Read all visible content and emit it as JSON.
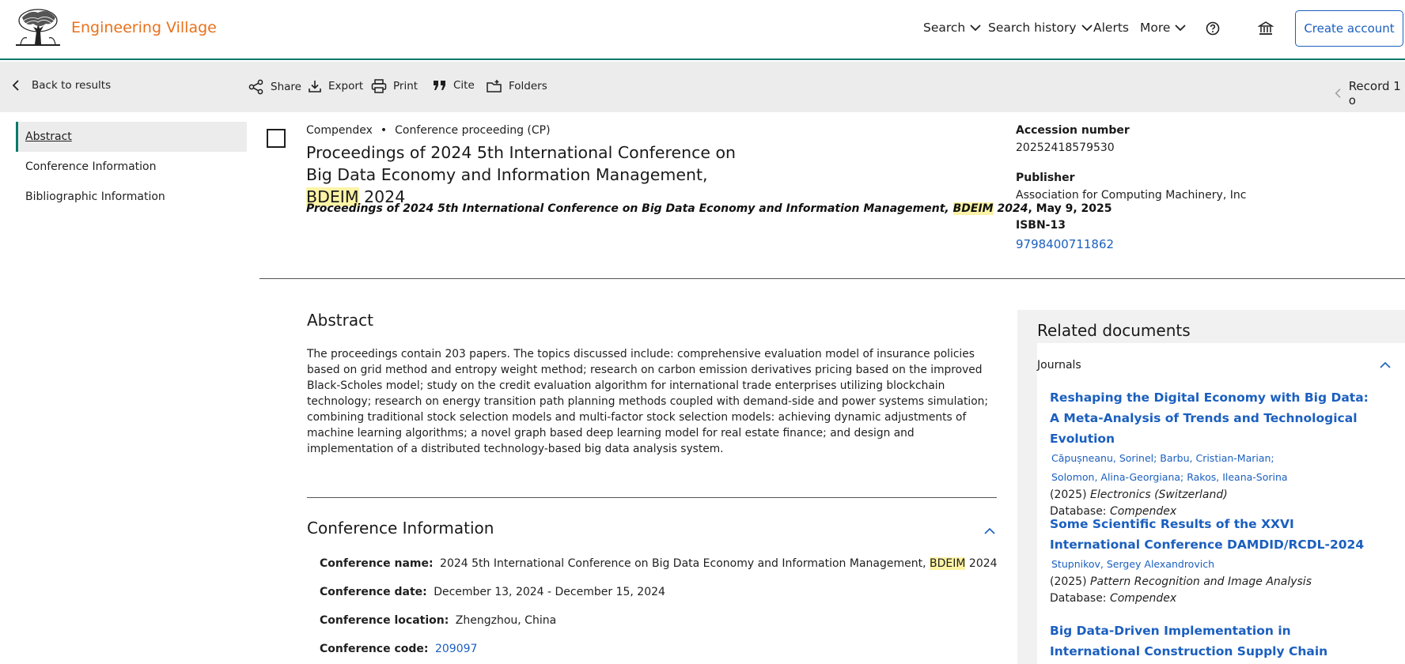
{
  "header": {
    "brand": "Engineering Village",
    "nav": {
      "search": "Search",
      "search_history": "Search history",
      "alerts": "Alerts",
      "more": "More"
    },
    "create_account": "Create account"
  },
  "toolbar": {
    "back": "Back to results",
    "share": "Share",
    "export": "Export",
    "print": "Print",
    "cite": "Cite",
    "folders": "Folders",
    "record": "Record 1 o"
  },
  "toc": {
    "abstract": "Abstract",
    "conference": "Conference Information",
    "bibliographic": "Bibliographic Information"
  },
  "record": {
    "database": "Compendex",
    "doc_type": "Conference proceeding (CP)",
    "title_part1": "Proceedings of 2024 5th International Conference on Big Data Economy and Information Management, ",
    "title_highlight": "BDEIM",
    "title_part2": " 2024",
    "source_part1": "Proceedings of 2024 5th International Conference on Big Data Economy and Information Management, ",
    "source_highlight": "BDEIM",
    "source_part2": " 2024",
    "source_date": ", May 9, 2025"
  },
  "meta": {
    "accession_label": "Accession number",
    "accession_value": "20252418579530",
    "publisher_label": "Publisher",
    "publisher_value": "Association for Computing Machinery, Inc",
    "isbn_label": "ISBN-13",
    "isbn_value": "9798400711862"
  },
  "abstract": {
    "title": "Abstract",
    "text": "The proceedings contain 203 papers. The topics discussed include: comprehensive evaluation model of insurance policies based on grid method and entropy weight method; research on carbon emission derivatives pricing based on the improved Black-Scholes model; study on the credit evaluation algorithm for international trade enterprises utilizing blockchain technology; research on energy transition path planning methods coupled with demand-side and power systems simulation; combining traditional stock selection models and multi-factor stock selection models: achieving dynamic adjustments of machine learning algorithms; a novel graph based deep learning model for real estate finance; and design and implementation of a distributed technology-based big data analysis system."
  },
  "conference": {
    "title": "Conference Information",
    "name_label": "Conference name:",
    "name_part1": "2024 5th International Conference on Big Data Economy and Information Management, ",
    "name_highlight": "BDEIM",
    "name_part2": " 2024",
    "date_label": "Conference date:",
    "date_value": "December 13, 2024 - December 15, 2024",
    "location_label": "Conference location:",
    "location_value": "Zhengzhou, China",
    "code_label": "Conference code:",
    "code_value": "209097"
  },
  "related": {
    "title": "Related documents",
    "section": "Journals",
    "items": [
      {
        "title": "Reshaping the Digital Economy with Big Data: A Meta-Analysis of Trends and Technological Evolution",
        "authors1": "Căpușneanu, Sorinel;  Barbu, Cristian-Marian;",
        "authors2": "Solomon, Alina-Georgiana;  Rakos, Ileana-Sorina",
        "year": "(2025) ",
        "journal": "Electronics (Switzerland)",
        "db_label": "Database: ",
        "db": "Compendex"
      },
      {
        "title": "Some Scientific Results of the XXVI International Conference DAMDID/RCDL-2024",
        "authors1": "Stupnikov, Sergey Alexandrovich",
        "year": "(2025) ",
        "journal": "Pattern Recognition and Image Analysis",
        "db_label": "Database: ",
        "db": "Compendex"
      },
      {
        "title": "Big Data-Driven Implementation in International Construction Supply Chain Management: Framework"
      }
    ]
  },
  "colors": {
    "brand": "#e9711c",
    "link": "#1b5fbf",
    "accent": "#0a7a6a",
    "highlight": "#fdf3a6"
  }
}
